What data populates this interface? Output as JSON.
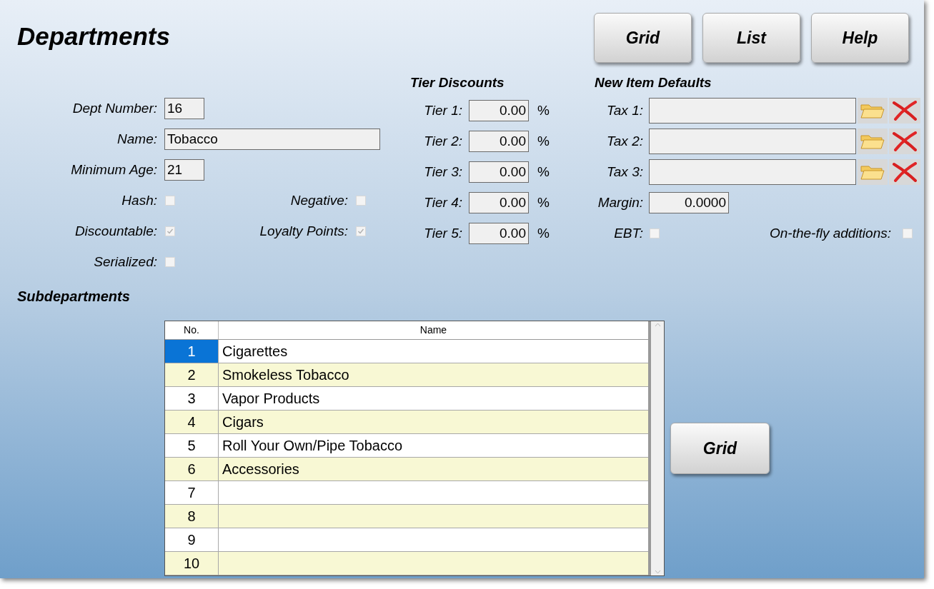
{
  "title": "Departments",
  "header_buttons": [
    "Grid",
    "List",
    "Help"
  ],
  "fields": [
    {
      "label": "Dept Number:",
      "value": "16",
      "kind": "number"
    },
    {
      "label": "Name:",
      "value": "Tobacco",
      "kind": "text"
    },
    {
      "label": "Minimum Age:",
      "value": "21",
      "kind": "number"
    }
  ],
  "checkbox_rows": [
    [
      {
        "label": "Hash:",
        "checked": false
      },
      {
        "label": "Negative:",
        "checked": false
      }
    ],
    [
      {
        "label": "Discountable:",
        "checked": true
      },
      {
        "label": "Loyalty Points:",
        "checked": true
      }
    ],
    [
      {
        "label": "Serialized:",
        "checked": false
      }
    ]
  ],
  "tier_discounts": {
    "title": "Tier Discounts",
    "rows": [
      {
        "label": "Tier 1:",
        "value": "0.00",
        "unit": "%"
      },
      {
        "label": "Tier 2:",
        "value": "0.00",
        "unit": "%"
      },
      {
        "label": "Tier 3:",
        "value": "0.00",
        "unit": "%"
      },
      {
        "label": "Tier 4:",
        "value": "0.00",
        "unit": "%"
      },
      {
        "label": "Tier 5:",
        "value": "0.00",
        "unit": "%"
      }
    ]
  },
  "new_item_defaults": {
    "title": "New Item Defaults",
    "taxes": [
      {
        "label": "Tax 1:"
      },
      {
        "label": "Tax 2:"
      },
      {
        "label": "Tax 3:"
      }
    ],
    "margin": {
      "label": "Margin:",
      "value": "0.0000"
    },
    "ebt": {
      "label": "EBT:",
      "checked": false
    },
    "on_the_fly": {
      "label": "On-the-fly additions:",
      "checked": false
    }
  },
  "subdepartments": {
    "title": "Subdepartments",
    "columns": [
      "No.",
      "Name"
    ],
    "rows": [
      {
        "no": "1",
        "name": "Cigarettes",
        "selected": true
      },
      {
        "no": "2",
        "name": "Smokeless Tobacco",
        "selected": false
      },
      {
        "no": "3",
        "name": "Vapor Products",
        "selected": false
      },
      {
        "no": "4",
        "name": "Cigars",
        "selected": false
      },
      {
        "no": "5",
        "name": "Roll Your Own/Pipe Tobacco",
        "selected": false
      },
      {
        "no": "6",
        "name": "Accessories",
        "selected": false
      },
      {
        "no": "7",
        "selected": false
      },
      {
        "no": "8",
        "selected": false
      },
      {
        "no": "9",
        "selected": false
      },
      {
        "no": "10",
        "selected": false
      }
    ],
    "button": "Grid"
  }
}
